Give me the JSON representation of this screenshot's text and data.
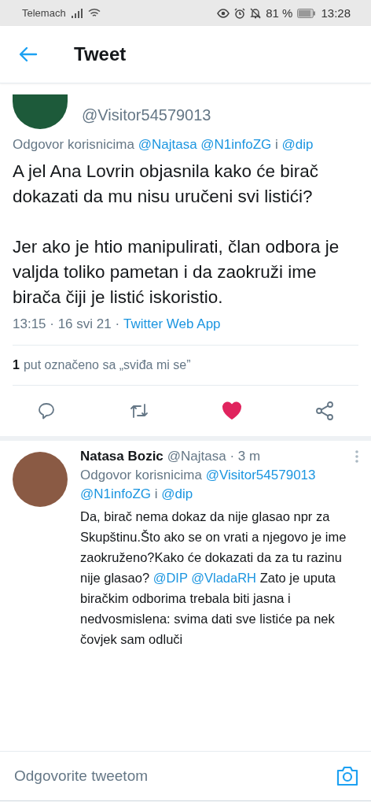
{
  "status_bar": {
    "carrier": "Telemach",
    "battery": "81 %",
    "time": "13:28"
  },
  "header": {
    "title": "Tweet"
  },
  "tweet": {
    "handle": "@Visitor54579013",
    "reply_to": [
      {
        "kind": "text",
        "text": "Odgovor korisnicima"
      },
      {
        "kind": "mention",
        "text": "@Najtasa"
      },
      {
        "kind": "mention",
        "text": "@N1infoZG"
      },
      {
        "kind": "text",
        "text": "i"
      },
      {
        "kind": "mention",
        "text": "@dip"
      }
    ],
    "paragraphs": [
      "A jel Ana Lovrin objasnila kako će birač dokazati da mu nisu uručeni svi listići?",
      "Jer ako je htio manipulirati, član odbora je valjda toliko pametan i da zaokruži ime birača čiji je listić iskoristio."
    ],
    "timestamp": "13:15 · 16 svi 21 ·",
    "source": "Twitter Web App",
    "likes": {
      "count": "1",
      "label": "put označeno sa „sviđa mi se”"
    },
    "actions": [
      {
        "kind": "reply"
      },
      {
        "kind": "retweet"
      },
      {
        "kind": "like",
        "selected": true
      },
      {
        "kind": "share"
      }
    ]
  },
  "reply": {
    "name": "Natasa Bozic",
    "meta": "@Najtasa · 3 m",
    "reply_to": [
      {
        "kind": "text",
        "text": "Odgovor korisnicima"
      },
      {
        "kind": "mention",
        "text": "@Visitor54579013"
      },
      {
        "kind": "mention",
        "text": "@N1infoZG"
      },
      {
        "kind": "text",
        "text": "i"
      },
      {
        "kind": "mention",
        "text": "@dip"
      }
    ],
    "body": [
      {
        "kind": "text",
        "text": "Da, birač nema dokaz da nije glasao npr za Skupštinu.Što ako se on vrati a njegovo je ime zaokruženo?Kako će dokazati da za tu razinu nije glasao?"
      },
      {
        "kind": "mention",
        "text": "@DIP"
      },
      {
        "kind": "mention",
        "text": "@VladaRH"
      },
      {
        "kind": "text",
        "text": "Zato je uputa biračkim odborima trebala biti jasna i nedvosmislena: svima dati sve listiće pa nek čovjek sam odluči"
      }
    ]
  },
  "composer": {
    "placeholder": "Odgovorite tweetom"
  }
}
